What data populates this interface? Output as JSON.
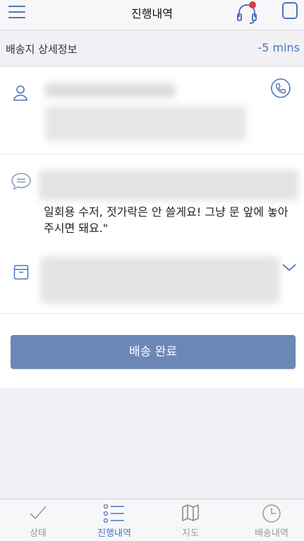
{
  "header": {
    "title": "진행내역"
  },
  "subheader": {
    "label": "배송지 상세정보",
    "time": "-5 mins"
  },
  "details": {
    "note": "일회용 수저, 젓가락은 안 쓸게요! 그냥 문 앞에 놓아 주시면 돼요.\""
  },
  "action": {
    "complete_label": "배송 완료"
  },
  "tabs": [
    {
      "label": "상태"
    },
    {
      "label": "진행내역"
    },
    {
      "label": "지도"
    },
    {
      "label": "배송내역"
    }
  ],
  "colors": {
    "accent": "#4c76b8",
    "button": "#6a87b6",
    "notification": "#e03c3c"
  }
}
